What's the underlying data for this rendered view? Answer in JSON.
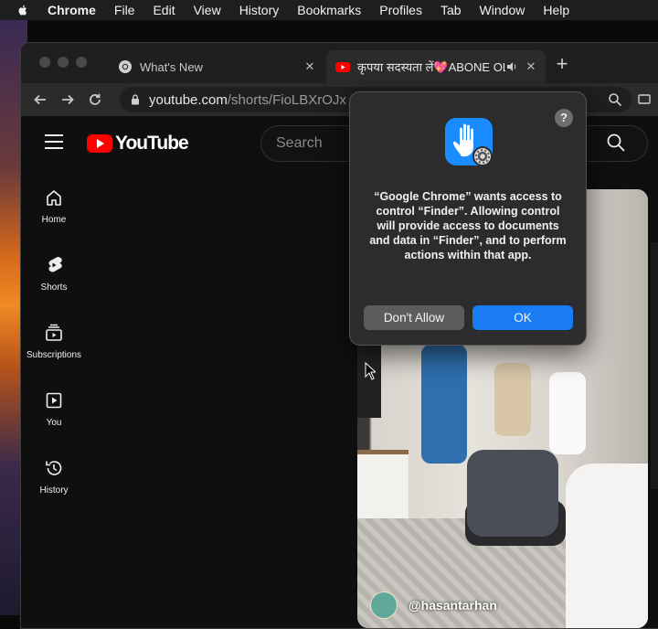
{
  "menubar": {
    "items": [
      "Chrome",
      "File",
      "Edit",
      "View",
      "History",
      "Bookmarks",
      "Profiles",
      "Tab",
      "Window",
      "Help"
    ]
  },
  "tabs": [
    {
      "title": "What's New",
      "icon": "chrome-icon",
      "active": false
    },
    {
      "title": "कृपया सदस्यता लें💖ABONE OL",
      "icon": "youtube-icon",
      "active": true,
      "audio": true
    }
  ],
  "toolbar": {
    "url_host": "youtube.com",
    "url_path": "/shorts/FioLBXrOJx"
  },
  "youtube": {
    "logo_text": "YouTube",
    "search_placeholder": "Search",
    "sidebar": [
      {
        "label": "Home",
        "icon": "home-icon"
      },
      {
        "label": "Shorts",
        "icon": "shorts-icon"
      },
      {
        "label": "Subscriptions",
        "icon": "subscriptions-icon"
      },
      {
        "label": "You",
        "icon": "you-icon"
      },
      {
        "label": "History",
        "icon": "history-icon"
      }
    ],
    "video": {
      "channel_handle": "@hasantarhan"
    }
  },
  "dialog": {
    "message": "“Google Chrome” wants access to control “Finder”. Allowing control will provide access to documents and data in “Finder”, and to perform actions within that app.",
    "deny_label": "Don't Allow",
    "ok_label": "OK",
    "help_label": "?"
  },
  "colors": {
    "accent": "#1a7cf4",
    "youtube_red": "#ff0000"
  }
}
